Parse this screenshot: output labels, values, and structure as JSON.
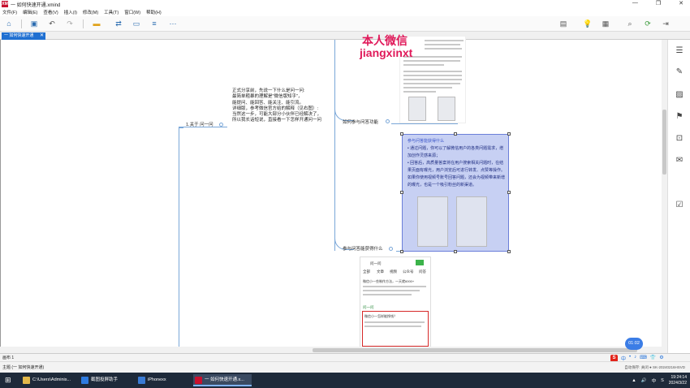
{
  "window": {
    "title": "一 如何快速开通.xmind",
    "logo": "XM",
    "controls": [
      "—",
      "❐",
      "✕"
    ]
  },
  "menu": [
    "文件(F)",
    "编辑(E)",
    "查看(V)",
    "插入(I)",
    "修改(M)",
    "工具(T)",
    "窗口(W)",
    "帮助(H)"
  ],
  "tab": {
    "label": "一 如何快速开通",
    "close": "✕"
  },
  "mindmap": {
    "topic_1": "1.关于 问一问",
    "note_lines": [
      "正式分享前，先说一下什么是问一问:",
      "最简单粗暴的理解是\"微信版知乎\"，",
      "能提问、能回答、能关注、能引流。",
      "详细版，参考微信官方给的解释（见右图）:",
      "当然这一步，可能大部分小伙伴已经解决了，",
      "所以我长话短说，直接看一下怎样开通问一问"
    ],
    "topic_feature": "如何参与问答功能",
    "topic_benefit": "参与问答能获得什么"
  },
  "selected_image": {
    "heading": "参与问答能获得什么",
    "bullets": [
      "• 通过问题，你可以了解微信用户的各类问题需求，增加创作灵感来源；",
      "• 回答后，高质量答案将在用户搜索相关问题时，在结果页面有曝光，用户浏览后可进行转发、点赞等操作。如果你使用视频号账号回答问题，还会为视频带来新增的曝光，也是一个吸引粉丝的新渠道。"
    ]
  },
  "lower_image": {
    "search": "问一问",
    "tab_labels": [
      "全部",
      "文章",
      "视频",
      "公众号",
      "问答"
    ],
    "question_1": "微信小一些制作方法，一天就6000+",
    "question_2": "微信小一怎样能挣钱？",
    "link": "问一问"
  },
  "watermark": {
    "line1": "本人微信",
    "line2": "jiangxinxt"
  },
  "statusbar": {
    "sheet": "画布 1",
    "topic_label": "主题 (一 如何快速开通)",
    "right": "自动保存: 关闭   ● SK-20240216HSVD"
  },
  "timer": "01:02",
  "ime_label": "S",
  "ime_items": [
    "中",
    "•",
    "♪",
    "⌨",
    "👕",
    "⚙"
  ],
  "taskbar": {
    "items": [
      {
        "label": "C:\\Users\\Adminis...",
        "color": "#e2b84a"
      },
      {
        "label": "截图投屏助手",
        "color": "#2e7be0"
      },
      {
        "label": "iPhonexx",
        "color": "#3a7bd5"
      },
      {
        "label": "一 如何快速开通.x...",
        "color": "#c8102e",
        "active": true
      }
    ],
    "tray_icons": [
      "▲",
      "🔊",
      "中",
      "S"
    ],
    "clock_time": "19:24:14",
    "clock_date": "2024/3/22"
  },
  "right_panel_icons": [
    "list-icon",
    "brush-icon",
    "image-icon",
    "flag-icon",
    "tag-icon",
    "comment-icon",
    "task-icon"
  ]
}
